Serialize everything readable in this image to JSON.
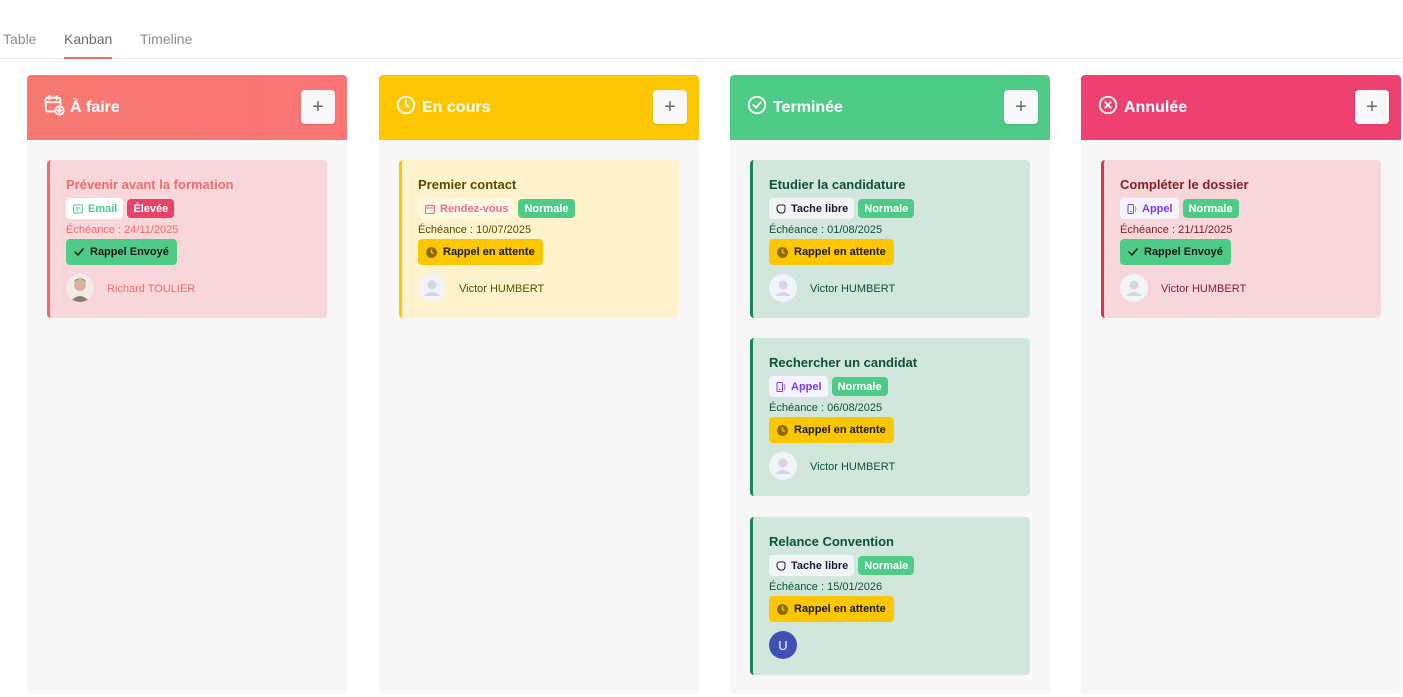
{
  "tabs": [
    {
      "label": "Table",
      "active": false
    },
    {
      "label": "Kanban",
      "active": true
    },
    {
      "label": "Timeline",
      "active": false
    }
  ],
  "colors": {
    "todo": "#fc7575",
    "inprogress": "#fdc700",
    "done": "#4fcb88",
    "cancelled": "#ef416f",
    "priority_normal": "#4fcb88",
    "priority_high": "#e8416a"
  },
  "columns": [
    {
      "title": "À faire",
      "icon": "calendar-add-icon",
      "add_label": "+",
      "cards": [
        {
          "title": "Prévenir avant la formation",
          "type": "Email",
          "type_icon": "email-icon",
          "priority": "Élevée",
          "due": "Échéance : 24/11/2025",
          "rappel": "Rappel Envoyé",
          "rappel_icon": "check-icon",
          "person": "Richard TOULIER",
          "avatar": "photo-avatar"
        }
      ]
    },
    {
      "title": "En cours",
      "icon": "clock-icon",
      "add_label": "+",
      "cards": [
        {
          "title": "Premier contact",
          "type": "Rendez-vous",
          "type_icon": "calendar-icon",
          "priority": "Normale",
          "due": "Échéance : 10/07/2025",
          "rappel": "Rappel en attente",
          "rappel_icon": "clock-icon",
          "person": "Victor HUMBERT",
          "avatar": "user-placeholder"
        }
      ]
    },
    {
      "title": "Terminée",
      "icon": "check-circle-icon",
      "add_label": "+",
      "cards": [
        {
          "title": "Etudier la candidature",
          "type": "Tache libre",
          "type_icon": "task-icon",
          "priority": "Normale",
          "due": "Échéance : 01/08/2025",
          "rappel": "Rappel en attente",
          "rappel_icon": "clock-icon",
          "person": "Victor HUMBERT",
          "avatar": "user-placeholder"
        },
        {
          "title": "Rechercher un candidat",
          "type": "Appel",
          "type_icon": "phone-icon",
          "priority": "Normale",
          "due": "Échéance : 06/08/2025",
          "rappel": "Rappel en attente",
          "rappel_icon": "clock-icon",
          "person": "Victor HUMBERT",
          "avatar": "user-placeholder"
        },
        {
          "title": "Relance Convention",
          "type": "Tache libre",
          "type_icon": "task-icon",
          "priority": "Normale",
          "due": "Échéance : 15/01/2026",
          "rappel": "Rappel en attente",
          "rappel_icon": "clock-icon",
          "person": "",
          "avatar": "U"
        }
      ]
    },
    {
      "title": "Annulée",
      "icon": "x-circle-icon",
      "add_label": "+",
      "cards": [
        {
          "title": "Compléter le dossier",
          "type": "Appel",
          "type_icon": "phone-icon",
          "priority": "Normale",
          "due": "Échéance : 21/11/2025",
          "rappel": "Rappel Envoyé",
          "rappel_icon": "check-icon",
          "person": "Victor HUMBERT",
          "avatar": "user-placeholder"
        }
      ]
    }
  ]
}
